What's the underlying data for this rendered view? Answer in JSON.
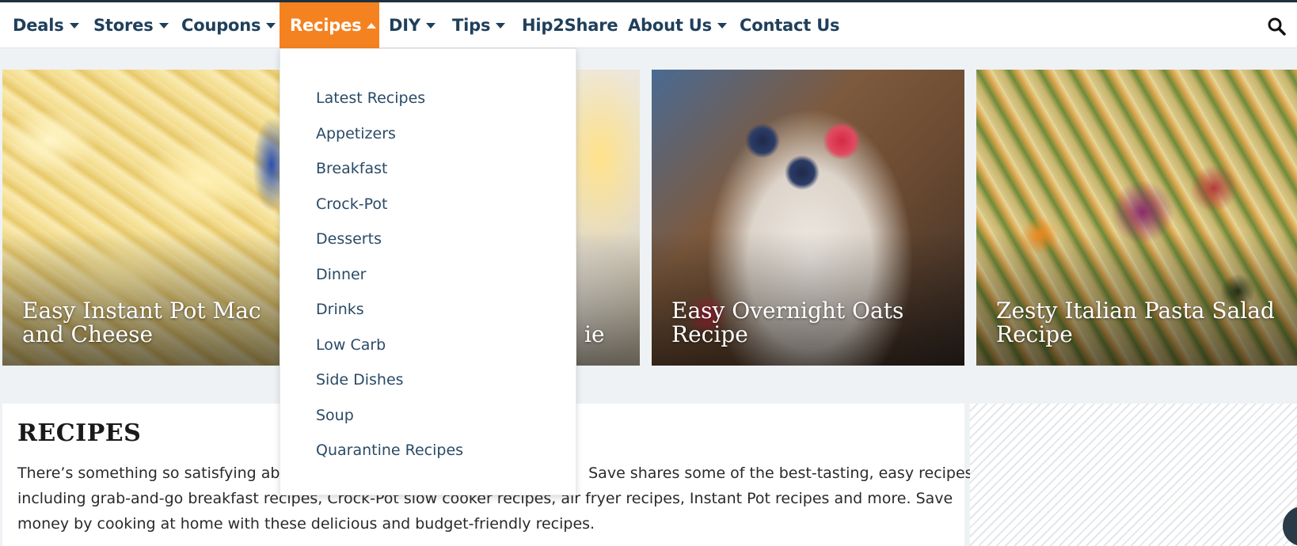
{
  "nav": {
    "items": [
      {
        "label": "Deals",
        "has_caret": true
      },
      {
        "label": "Stores",
        "has_caret": true
      },
      {
        "label": "Coupons",
        "has_caret": true
      },
      {
        "label": "Recipes",
        "has_caret": true,
        "active": true
      },
      {
        "label": "DIY",
        "has_caret": true
      },
      {
        "label": "Tips",
        "has_caret": true
      },
      {
        "label": "Hip2Share",
        "has_caret": false
      },
      {
        "label": "About Us",
        "has_caret": true
      },
      {
        "label": "Contact Us",
        "has_caret": false
      }
    ],
    "active_color": "#f58220",
    "text_color": "#1f3f5b",
    "search_icon": "search-icon"
  },
  "dropdown": {
    "items": [
      "Latest Recipes",
      "Appetizers",
      "Breakfast",
      "Crock-Pot",
      "Desserts",
      "Dinner",
      "Drinks",
      "Low Carb",
      "Side Dishes",
      "Soup",
      "Quarantine Recipes"
    ]
  },
  "cards": [
    {
      "title": "Easy Instant Pot Mac and Cheese"
    },
    {
      "title": "ie"
    },
    {
      "title": "Easy Overnight Oats Recipe"
    },
    {
      "title": "Zesty Italian Pasta Salad Recipe"
    }
  ],
  "recipes": {
    "heading": "RECIPES",
    "line1_a": "There’s something so satisfying abo",
    "line1_b": "Save shares some of the best-tasting, easy recipes",
    "line2_a": "including grab-and-go breakfast recipes, Crock-Pot slow cooker recipes, air fryer recipes, Instant Pot recipes and more. Save",
    "line3": "money by cooking at home with these delicious and budget-friendly recipes."
  }
}
